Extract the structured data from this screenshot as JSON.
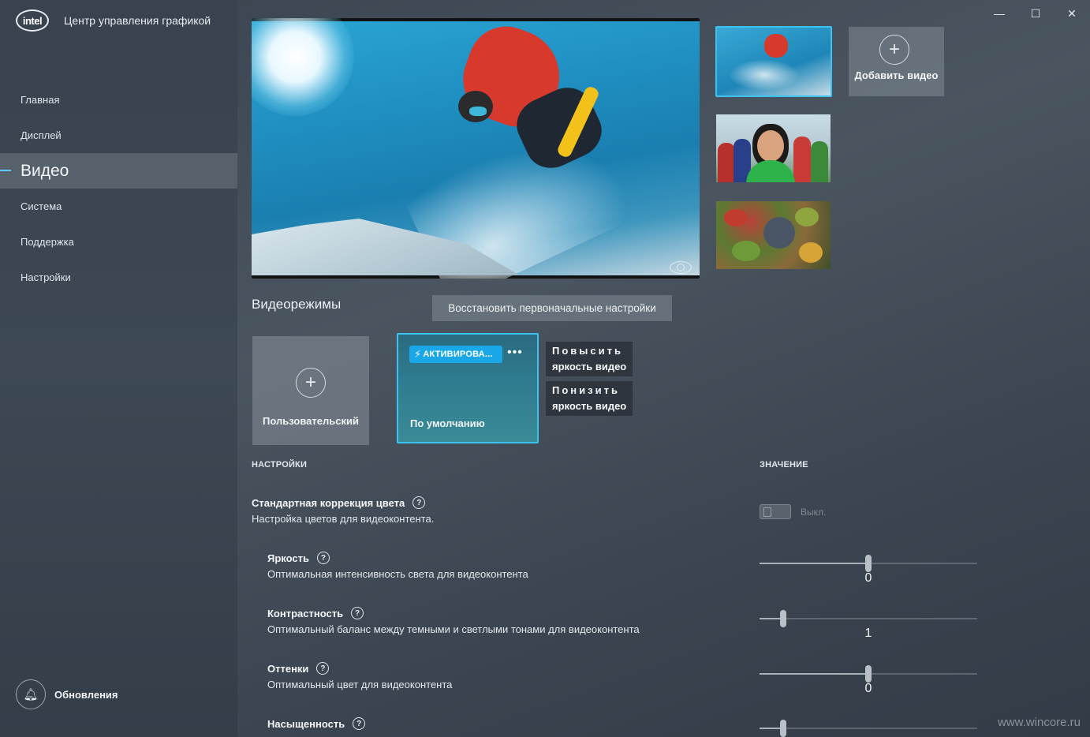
{
  "app": {
    "logo_text": "intel",
    "title": "Центр управления графикой"
  },
  "window_controls": {
    "minimize": "—",
    "maximize": "☐",
    "close": "✕"
  },
  "sidebar": {
    "items": [
      {
        "label": "Главная"
      },
      {
        "label": "Дисплей"
      },
      {
        "label": "Видео",
        "active": true
      },
      {
        "label": "Система"
      },
      {
        "label": "Поддержка"
      },
      {
        "label": "Настройки"
      }
    ],
    "updates_label": "Обновления"
  },
  "preview": {
    "add_video_label": "Добавить видео"
  },
  "video_modes": {
    "title": "Видеорежимы",
    "reset_label": "Восстановить первоначальные настройки",
    "custom_label": "Пользовательский",
    "default_badge": "АКТИВИРОВА...",
    "default_label": "По умолчанию",
    "more_label": "•••",
    "tips": [
      {
        "line1": "Повысить",
        "line2": "яркость видео"
      },
      {
        "line1": "Понизить",
        "line2": "яркость видео"
      }
    ]
  },
  "settings": {
    "col_settings": "НАСТРОЙКИ",
    "col_value": "ЗНАЧЕНИЕ",
    "color_correction": {
      "title": "Стандартная коррекция цвета",
      "desc": "Настройка цветов для видеоконтента.",
      "toggle_label": "Выкл."
    },
    "brightness": {
      "title": "Яркость",
      "desc": "Оптимальная интенсивность света для видеоконтента",
      "value": "0",
      "fraction": 0.5
    },
    "contrast": {
      "title": "Контрастность",
      "desc": "Оптимальный баланс между темными и светлыми тонами для видеоконтента",
      "value": "1",
      "fraction": 0.11
    },
    "hue": {
      "title": "Оттенки",
      "desc": "Оптимальный цвет для видеоконтента",
      "value": "0",
      "fraction": 0.5
    },
    "saturation": {
      "title": "Насыщенность",
      "fraction": 0.11
    }
  },
  "watermark": "www.wincore.ru",
  "colors": {
    "accent": "#3cc2f0",
    "badge": "#1aa7e8"
  }
}
